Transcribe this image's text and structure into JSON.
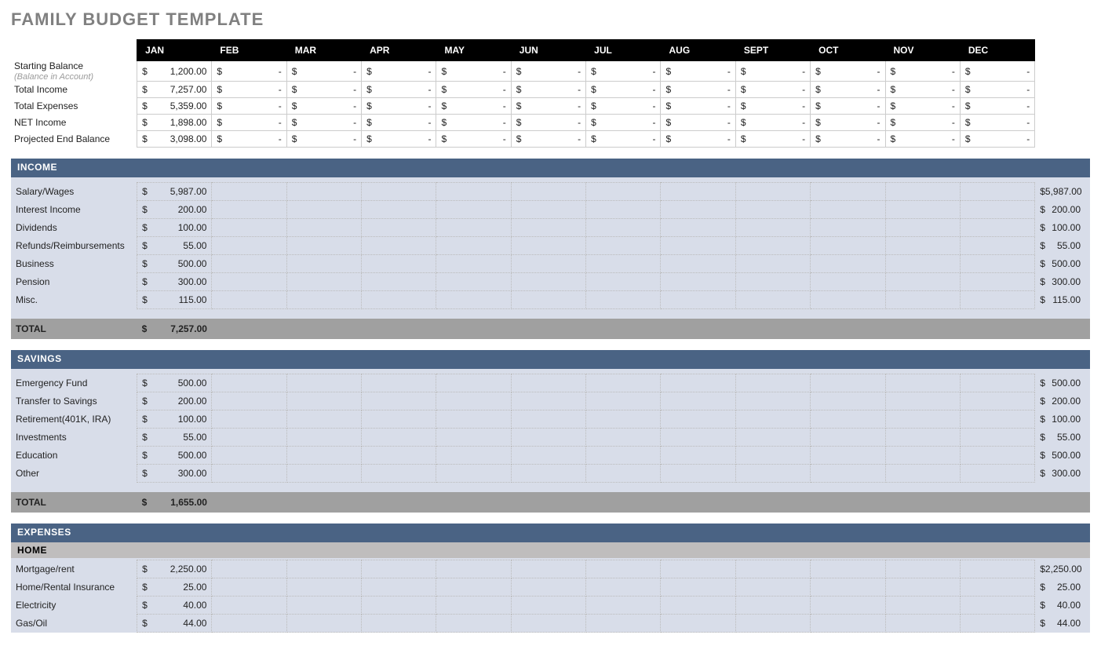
{
  "title": "FAMILY BUDGET TEMPLATE",
  "months": [
    "JAN",
    "FEB",
    "MAR",
    "APR",
    "MAY",
    "JUN",
    "JUL",
    "AUG",
    "SEPT",
    "OCT",
    "NOV",
    "DEC"
  ],
  "summary": {
    "label_start": "Starting Balance",
    "label_start_sub": "(Balance in Account)",
    "label_income": "Total Income",
    "label_expenses": "Total Expenses",
    "label_net": "NET Income",
    "label_proj": "Projected End Balance",
    "start": [
      "1,200.00",
      "-",
      "-",
      "-",
      "-",
      "-",
      "-",
      "-",
      "-",
      "-",
      "-",
      "-"
    ],
    "income": [
      "7,257.00",
      "-",
      "-",
      "-",
      "-",
      "-",
      "-",
      "-",
      "-",
      "-",
      "-",
      "-"
    ],
    "expenses": [
      "5,359.00",
      "-",
      "-",
      "-",
      "-",
      "-",
      "-",
      "-",
      "-",
      "-",
      "-",
      "-"
    ],
    "net": [
      "1,898.00",
      "-",
      "-",
      "-",
      "-",
      "-",
      "-",
      "-",
      "-",
      "-",
      "-",
      "-"
    ],
    "proj": [
      "3,098.00",
      "-",
      "-",
      "-",
      "-",
      "-",
      "-",
      "-",
      "-",
      "-",
      "-",
      "-"
    ]
  },
  "income_section": {
    "title": "INCOME",
    "rows": [
      {
        "label": "Salary/Wages",
        "vals": [
          "5,987.00",
          "",
          "",
          "",
          "",
          "",
          "",
          "",
          "",
          "",
          "",
          ""
        ],
        "total": "5,987.00"
      },
      {
        "label": "Interest Income",
        "vals": [
          "200.00",
          "",
          "",
          "",
          "",
          "",
          "",
          "",
          "",
          "",
          "",
          ""
        ],
        "total": "200.00"
      },
      {
        "label": "Dividends",
        "vals": [
          "100.00",
          "",
          "",
          "",
          "",
          "",
          "",
          "",
          "",
          "",
          "",
          ""
        ],
        "total": "100.00"
      },
      {
        "label": "Refunds/Reimbursements",
        "vals": [
          "55.00",
          "",
          "",
          "",
          "",
          "",
          "",
          "",
          "",
          "",
          "",
          ""
        ],
        "total": "55.00"
      },
      {
        "label": "Business",
        "vals": [
          "500.00",
          "",
          "",
          "",
          "",
          "",
          "",
          "",
          "",
          "",
          "",
          ""
        ],
        "total": "500.00"
      },
      {
        "label": "Pension",
        "vals": [
          "300.00",
          "",
          "",
          "",
          "",
          "",
          "",
          "",
          "",
          "",
          "",
          ""
        ],
        "total": "300.00"
      },
      {
        "label": "Misc.",
        "vals": [
          "115.00",
          "",
          "",
          "",
          "",
          "",
          "",
          "",
          "",
          "",
          "",
          ""
        ],
        "total": "115.00"
      }
    ],
    "total_label": "TOTAL",
    "total": "7,257.00"
  },
  "savings_section": {
    "title": "SAVINGS",
    "rows": [
      {
        "label": "Emergency Fund",
        "vals": [
          "500.00",
          "",
          "",
          "",
          "",
          "",
          "",
          "",
          "",
          "",
          "",
          ""
        ],
        "total": "500.00"
      },
      {
        "label": "Transfer to Savings",
        "vals": [
          "200.00",
          "",
          "",
          "",
          "",
          "",
          "",
          "",
          "",
          "",
          "",
          ""
        ],
        "total": "200.00"
      },
      {
        "label": "Retirement(401K, IRA)",
        "vals": [
          "100.00",
          "",
          "",
          "",
          "",
          "",
          "",
          "",
          "",
          "",
          "",
          ""
        ],
        "total": "100.00"
      },
      {
        "label": "Investments",
        "vals": [
          "55.00",
          "",
          "",
          "",
          "",
          "",
          "",
          "",
          "",
          "",
          "",
          ""
        ],
        "total": "55.00"
      },
      {
        "label": "Education",
        "vals": [
          "500.00",
          "",
          "",
          "",
          "",
          "",
          "",
          "",
          "",
          "",
          "",
          ""
        ],
        "total": "500.00"
      },
      {
        "label": "Other",
        "vals": [
          "300.00",
          "",
          "",
          "",
          "",
          "",
          "",
          "",
          "",
          "",
          "",
          ""
        ],
        "total": "300.00"
      }
    ],
    "total_label": "TOTAL",
    "total": "1,655.00"
  },
  "expenses_section": {
    "title": "EXPENSES",
    "sub_title": "HOME",
    "rows": [
      {
        "label": "Mortgage/rent",
        "vals": [
          "2,250.00",
          "",
          "",
          "",
          "",
          "",
          "",
          "",
          "",
          "",
          "",
          ""
        ],
        "total": "2,250.00"
      },
      {
        "label": "Home/Rental Insurance",
        "vals": [
          "25.00",
          "",
          "",
          "",
          "",
          "",
          "",
          "",
          "",
          "",
          "",
          ""
        ],
        "total": "25.00"
      },
      {
        "label": "Electricity",
        "vals": [
          "40.00",
          "",
          "",
          "",
          "",
          "",
          "",
          "",
          "",
          "",
          "",
          ""
        ],
        "total": "40.00"
      },
      {
        "label": "Gas/Oil",
        "vals": [
          "44.00",
          "",
          "",
          "",
          "",
          "",
          "",
          "",
          "",
          "",
          "",
          ""
        ],
        "total": "44.00"
      }
    ]
  }
}
